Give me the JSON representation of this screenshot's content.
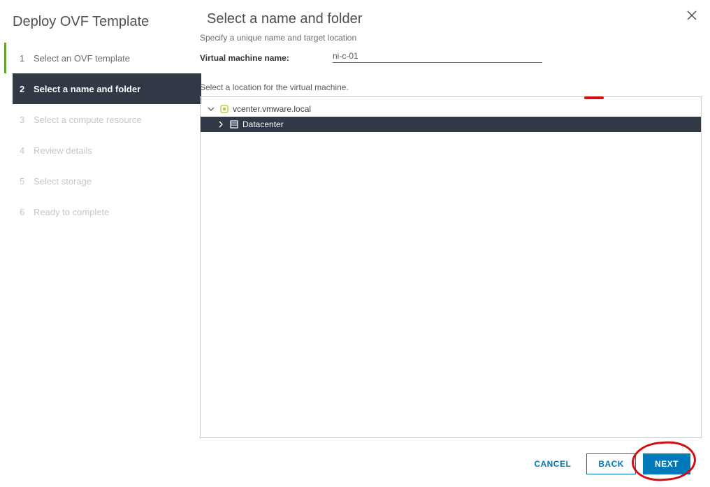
{
  "wizard": {
    "title": "Deploy OVF Template",
    "steps": [
      {
        "num": "1",
        "label": "Select an OVF template"
      },
      {
        "num": "2",
        "label": "Select a name and folder"
      },
      {
        "num": "3",
        "label": "Select a compute resource"
      },
      {
        "num": "4",
        "label": "Review details"
      },
      {
        "num": "5",
        "label": "Select storage"
      },
      {
        "num": "6",
        "label": "Ready to complete"
      }
    ]
  },
  "page": {
    "heading": "Select a name and folder",
    "subtitle": "Specify a unique name and target location",
    "vm_name_label": "Virtual machine name:",
    "vm_name_value": "ni-c-01",
    "location_label": "Select a location for the virtual machine.",
    "tree": {
      "root": {
        "label": "vcenter.vmware.local"
      },
      "child": {
        "label": "Datacenter"
      }
    }
  },
  "footer": {
    "cancel": "CANCEL",
    "back": "BACK",
    "next": "NEXT"
  }
}
